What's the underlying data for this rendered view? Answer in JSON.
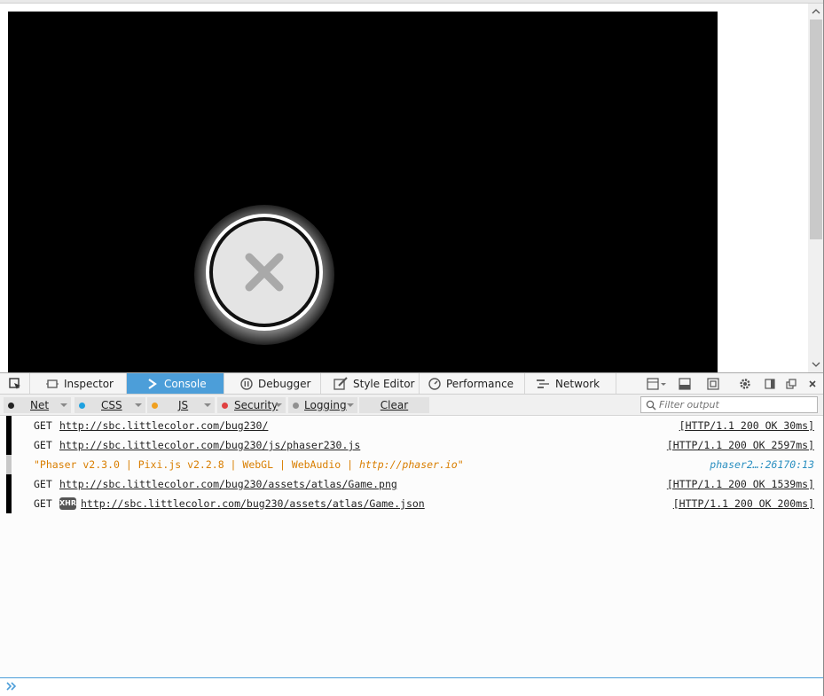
{
  "devtools": {
    "tabs": [
      {
        "label": "Inspector",
        "icon": "inspector-icon"
      },
      {
        "label": "Console",
        "icon": "console-icon",
        "selected": true
      },
      {
        "label": "Debugger",
        "icon": "debugger-icon"
      },
      {
        "label": "Style Editor",
        "icon": "style-editor-icon"
      },
      {
        "label": "Performance",
        "icon": "performance-icon"
      },
      {
        "label": "Network",
        "icon": "network-icon"
      }
    ],
    "accent_color": "#4c9ed9"
  },
  "filters": {
    "net": {
      "label": "Net",
      "color": "#222222"
    },
    "css": {
      "label": "CSS",
      "color": "#1ea1e0"
    },
    "js": {
      "label": "JS",
      "color": "#f0a020"
    },
    "security": {
      "label": "Security",
      "color": "#e04040"
    },
    "logging": {
      "label": "Logging",
      "color": "#909090"
    },
    "clear_label": "Clear",
    "filter_placeholder": "Filter output"
  },
  "console": {
    "rows": [
      {
        "method": "GET",
        "url": "http://sbc.littlecolor.com/bug230/",
        "status": "[HTTP/1.1 200 OK 30ms]"
      },
      {
        "method": "GET",
        "url": "http://sbc.littlecolor.com/bug230/js/phaser230.js",
        "status": "[HTTP/1.1 200 OK 2597ms]"
      },
      {
        "message": "\"Phaser v2.3.0 | Pixi.js v2.2.8 | WebGL | WebAudio | ",
        "message_link": "http://phaser.io",
        "message_end": "\"",
        "location": "phaser2…:26170:13"
      },
      {
        "method": "GET",
        "url": "http://sbc.littlecolor.com/bug230/assets/atlas/Game.png",
        "status": "[HTTP/1.1 200 OK 1539ms]"
      },
      {
        "method": "GET",
        "badge": "XHR",
        "url": "http://sbc.littlecolor.com/bug230/assets/atlas/Game.json",
        "status": "[HTTP/1.1 200 OK 200ms]"
      }
    ]
  }
}
